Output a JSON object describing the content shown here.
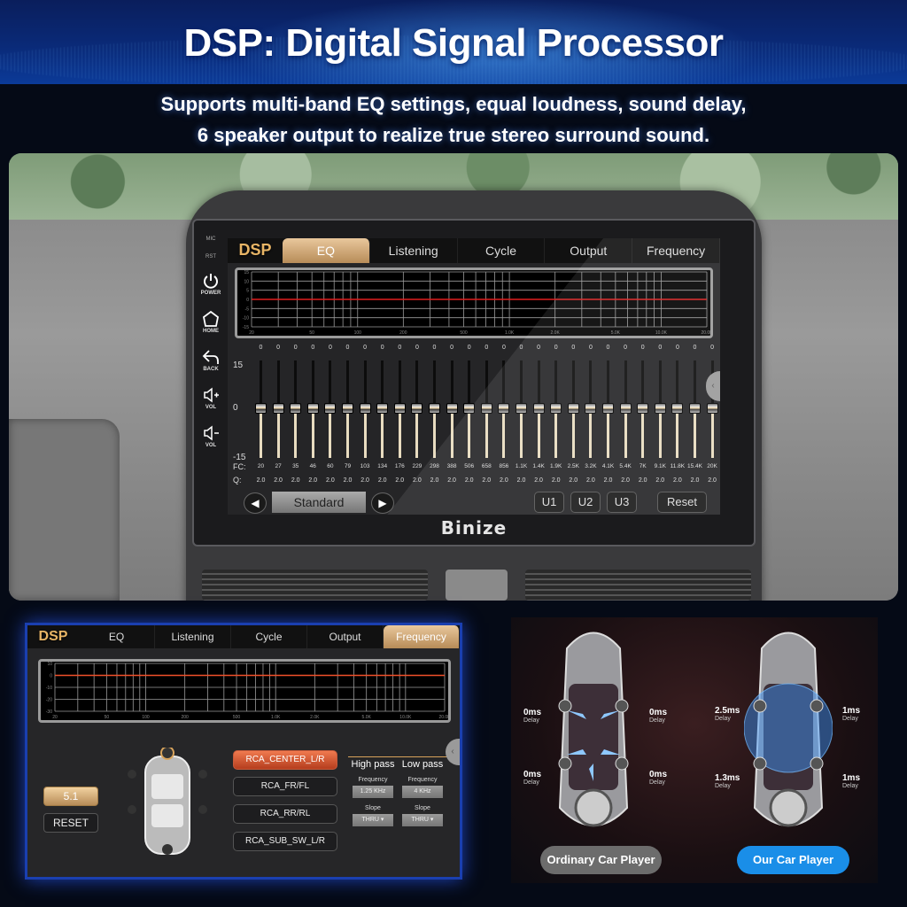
{
  "header": {
    "title": "DSP: Digital Signal Processor",
    "subtitle_line1": "Supports multi-band EQ settings, equal loudness, sound delay,",
    "subtitle_line2": "6 speaker output to realize true stereo surround sound."
  },
  "head_unit": {
    "side_keys": [
      {
        "label": "MIC",
        "icon": "mic-dot"
      },
      {
        "label": "RST",
        "icon": "reset-dot"
      },
      {
        "label": "POWER",
        "icon": "power-icon"
      },
      {
        "label": "HOME",
        "icon": "home-icon"
      },
      {
        "label": "BACK",
        "icon": "back-icon"
      },
      {
        "label": "VOL",
        "icon": "volume-up-icon"
      },
      {
        "label": "VOL",
        "icon": "volume-down-icon"
      }
    ],
    "brand": "Binize"
  },
  "main_screen": {
    "logo": "DSP",
    "tabs": [
      {
        "label": "EQ",
        "active": true
      },
      {
        "label": "Listening",
        "active": false
      },
      {
        "label": "Cycle",
        "active": false
      },
      {
        "label": "Output",
        "active": false
      },
      {
        "label": "Frequency",
        "active": false
      }
    ],
    "graph": {
      "y_ticks": [
        "15",
        "10",
        "5",
        "0",
        "-5",
        "-10",
        "-15"
      ],
      "x_ticks": [
        "20",
        "50",
        "100",
        "200",
        "500",
        "1.0K",
        "2.0K",
        "5.0K",
        "10.0K",
        "20.0K"
      ],
      "curve_color": "#e01e1e"
    },
    "eq": {
      "scale_top": "15",
      "scale_mid": "0",
      "scale_bottom": "-15",
      "fc_label": "FC:",
      "q_label": "Q:",
      "bands": [
        {
          "gain": "0",
          "fc": "20",
          "q": "2.0"
        },
        {
          "gain": "0",
          "fc": "27",
          "q": "2.0"
        },
        {
          "gain": "0",
          "fc": "35",
          "q": "2.0"
        },
        {
          "gain": "0",
          "fc": "46",
          "q": "2.0"
        },
        {
          "gain": "0",
          "fc": "60",
          "q": "2.0"
        },
        {
          "gain": "0",
          "fc": "79",
          "q": "2.0"
        },
        {
          "gain": "0",
          "fc": "103",
          "q": "2.0"
        },
        {
          "gain": "0",
          "fc": "134",
          "q": "2.0"
        },
        {
          "gain": "0",
          "fc": "176",
          "q": "2.0"
        },
        {
          "gain": "0",
          "fc": "229",
          "q": "2.0"
        },
        {
          "gain": "0",
          "fc": "298",
          "q": "2.0"
        },
        {
          "gain": "0",
          "fc": "388",
          "q": "2.0"
        },
        {
          "gain": "0",
          "fc": "506",
          "q": "2.0"
        },
        {
          "gain": "0",
          "fc": "658",
          "q": "2.0"
        },
        {
          "gain": "0",
          "fc": "856",
          "q": "2.0"
        },
        {
          "gain": "0",
          "fc": "1.1K",
          "q": "2.0"
        },
        {
          "gain": "0",
          "fc": "1.4K",
          "q": "2.0"
        },
        {
          "gain": "0",
          "fc": "1.9K",
          "q": "2.0"
        },
        {
          "gain": "0",
          "fc": "2.5K",
          "q": "2.0"
        },
        {
          "gain": "0",
          "fc": "3.2K",
          "q": "2.0"
        },
        {
          "gain": "0",
          "fc": "4.1K",
          "q": "2.0"
        },
        {
          "gain": "0",
          "fc": "5.4K",
          "q": "2.0"
        },
        {
          "gain": "0",
          "fc": "7K",
          "q": "2.0"
        },
        {
          "gain": "0",
          "fc": "9.1K",
          "q": "2.0"
        },
        {
          "gain": "0",
          "fc": "11.8K",
          "q": "2.0"
        },
        {
          "gain": "0",
          "fc": "15.4K",
          "q": "2.0"
        },
        {
          "gain": "0",
          "fc": "20K",
          "q": "2.0"
        }
      ]
    },
    "controls": {
      "prev_icon": "◀",
      "next_icon": "▶",
      "preset": "Standard",
      "u1": "U1",
      "u2": "U2",
      "u3": "U3",
      "reset": "Reset"
    },
    "handle_icon": "‹"
  },
  "frequency_panel": {
    "logo": "DSP",
    "tabs": [
      {
        "label": "EQ",
        "active": false
      },
      {
        "label": "Listening",
        "active": false
      },
      {
        "label": "Cycle",
        "active": false
      },
      {
        "label": "Output",
        "active": false
      },
      {
        "label": "Frequency",
        "active": true
      }
    ],
    "graph": {
      "y_ticks": [
        "10",
        "0",
        "-10",
        "-20",
        "-30"
      ],
      "x_ticks": [
        "20",
        "50",
        "100",
        "200",
        "500",
        "1.0K",
        "2.0K",
        "5.0K",
        "10.0K",
        "20.0K"
      ]
    },
    "mode_button": "5.1",
    "reset_button": "RESET",
    "outputs": [
      {
        "label": "RCA_CENTER_L/R",
        "active": true
      },
      {
        "label": "RCA_FR/FL",
        "active": false
      },
      {
        "label": "RCA_RR/RL",
        "active": false
      },
      {
        "label": "RCA_SUB_SW_L/R",
        "active": false
      }
    ],
    "high_pass": {
      "title": "High pass",
      "freq_label": "Frequency",
      "freq_value": "1.25 KHz",
      "slope_label": "Slope",
      "slope_value": "THRU"
    },
    "low_pass": {
      "title": "Low pass",
      "freq_label": "Frequency",
      "freq_value": "4 KHz",
      "slope_label": "Slope",
      "slope_value": "THRU"
    }
  },
  "comparison": {
    "ordinary": {
      "label": "Ordinary Car Player",
      "delays": [
        {
          "value": "0ms",
          "caption": "Delay"
        },
        {
          "value": "0ms",
          "caption": "Delay"
        },
        {
          "value": "0ms",
          "caption": "Delay"
        },
        {
          "value": "0ms",
          "caption": "Delay"
        }
      ]
    },
    "ours": {
      "label": "Our Car Player",
      "delays": [
        {
          "value": "2.5ms",
          "caption": "Delay"
        },
        {
          "value": "1ms",
          "caption": "Delay"
        },
        {
          "value": "1.3ms",
          "caption": "Delay"
        },
        {
          "value": "1ms",
          "caption": "Delay"
        }
      ]
    },
    "colors": {
      "ordinary_pill": "#6c6c6c",
      "our_pill": "#1a8ee8"
    }
  }
}
